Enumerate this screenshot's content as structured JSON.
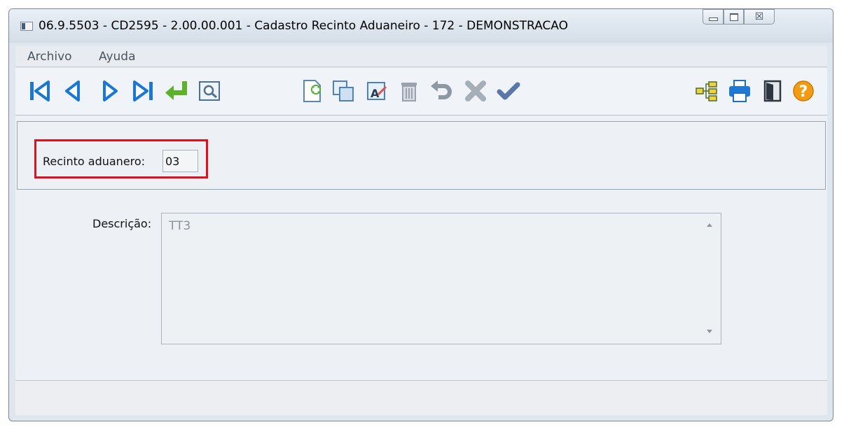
{
  "window": {
    "title": "06.9.5503 - CD2595 - 2.00.00.001 - Cadastro Recinto Aduaneiro - 172 - DEMONSTRACAO",
    "controls": {
      "minimize_icon": "minimize-icon",
      "maximize_icon": "maximize-icon",
      "close_icon": "close-icon",
      "close_glyph": "☒"
    }
  },
  "menubar": {
    "items": [
      {
        "label": "Archivo"
      },
      {
        "label": "Ayuda"
      }
    ]
  },
  "toolbar": {
    "buttons": [
      {
        "icon": "first-record-icon"
      },
      {
        "icon": "previous-record-icon"
      },
      {
        "icon": "next-record-icon"
      },
      {
        "icon": "last-record-icon"
      },
      {
        "icon": "goto-enter-icon"
      },
      {
        "icon": "search-icon"
      },
      {
        "icon": "new-document-icon"
      },
      {
        "icon": "copy-icon"
      },
      {
        "icon": "edit-text-icon"
      },
      {
        "icon": "delete-trash-icon"
      },
      {
        "icon": "undo-icon"
      },
      {
        "icon": "cancel-icon"
      },
      {
        "icon": "confirm-check-icon"
      },
      {
        "icon": "hierarchy-icon"
      },
      {
        "icon": "print-icon"
      },
      {
        "icon": "exit-door-icon"
      },
      {
        "icon": "help-icon"
      }
    ],
    "colors": {
      "nav_blue": "#1a78d4",
      "enter_green": "#5cb22a",
      "new_green": "#4caf2a",
      "help_orange": "#f39c12",
      "gray": "#9aa3ad",
      "check_blue": "#5978a8"
    }
  },
  "form": {
    "recinto": {
      "label": "Recinto aduanero:",
      "value": "03"
    },
    "descricao": {
      "label": "Descrição:",
      "value": "TT3"
    },
    "highlight_color": "#e0111c"
  }
}
